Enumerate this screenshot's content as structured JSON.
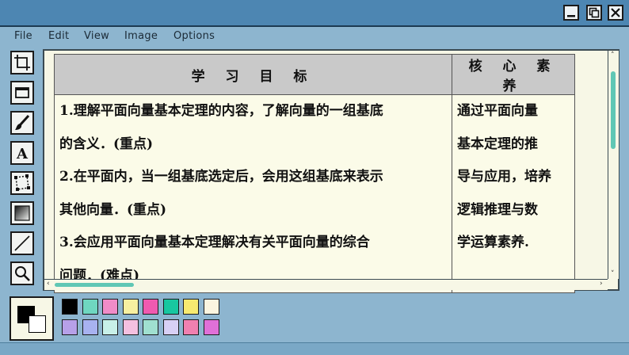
{
  "window": {
    "buttons": {
      "minimize": "minimize-icon",
      "maximize": "maximize-icon",
      "close": "close-icon"
    }
  },
  "menu": [
    "File",
    "Edit",
    "View",
    "Image",
    "Options"
  ],
  "tools": [
    "crop-icon",
    "rectangle-select-icon",
    "brush-icon",
    "text-icon",
    "free-select-icon",
    "gradient-icon",
    "line-icon",
    "magnifier-icon"
  ],
  "table": {
    "headers": [
      "学 习 目 标",
      "核 心 素 养"
    ],
    "goals": [
      "1.理解平面向量基本定理的内容，了解向量的一组基底",
      "的含义．(重点)",
      "2.在平面内，当一组基底选定后，会用这组基底来表示",
      "其他向量．(重点)",
      "3.会应用平面向量基本定理解决有关平面向量的综合",
      "问题．(难点)"
    ],
    "literacy": [
      "通过平面向量",
      "基本定理的推",
      "导与应用，培养",
      "逻辑推理与数",
      "学运算素养."
    ]
  },
  "palette": {
    "current_fg": "#000000",
    "current_bg": "#ffffff",
    "row1": [
      "#000000",
      "#6fd7c0",
      "#f08cc8",
      "#f7f0a0",
      "#f05ab0",
      "#18c7a0",
      "#f7ea70",
      "#fbf5e0"
    ],
    "row2": [
      "#b7a0e8",
      "#a8b2f0",
      "#c8f0e8",
      "#f5c0e0",
      "#a0e0d0",
      "#d8d0f5",
      "#f080b0",
      "#e070d8"
    ]
  },
  "scroll": {
    "left_arrow": "‹",
    "right_arrow": "›",
    "up_arrow": "˄",
    "down_arrow": "˅"
  }
}
